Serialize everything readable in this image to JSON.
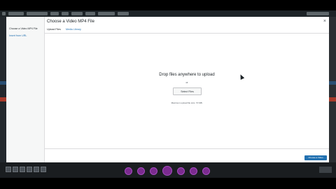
{
  "modal": {
    "title": "Choose a Video MP4 File",
    "close_glyph": "×"
  },
  "sidebar": {
    "active_item": "Choose a Video MP4 File",
    "link_item": "Insert from URL"
  },
  "tabs": [
    {
      "label": "Upload Files"
    },
    {
      "label": "Media Library"
    }
  ],
  "upload": {
    "drop_text": "Drop files anywhere to upload",
    "or_text": "or",
    "select_button": "Select Files",
    "max_size": "Maximum upload file size: 70 MB."
  },
  "footer": {
    "primary_button": "Choose a Video"
  },
  "colors": {
    "accent": "#2271b1",
    "toolbar_button": "#7b2b8f"
  }
}
